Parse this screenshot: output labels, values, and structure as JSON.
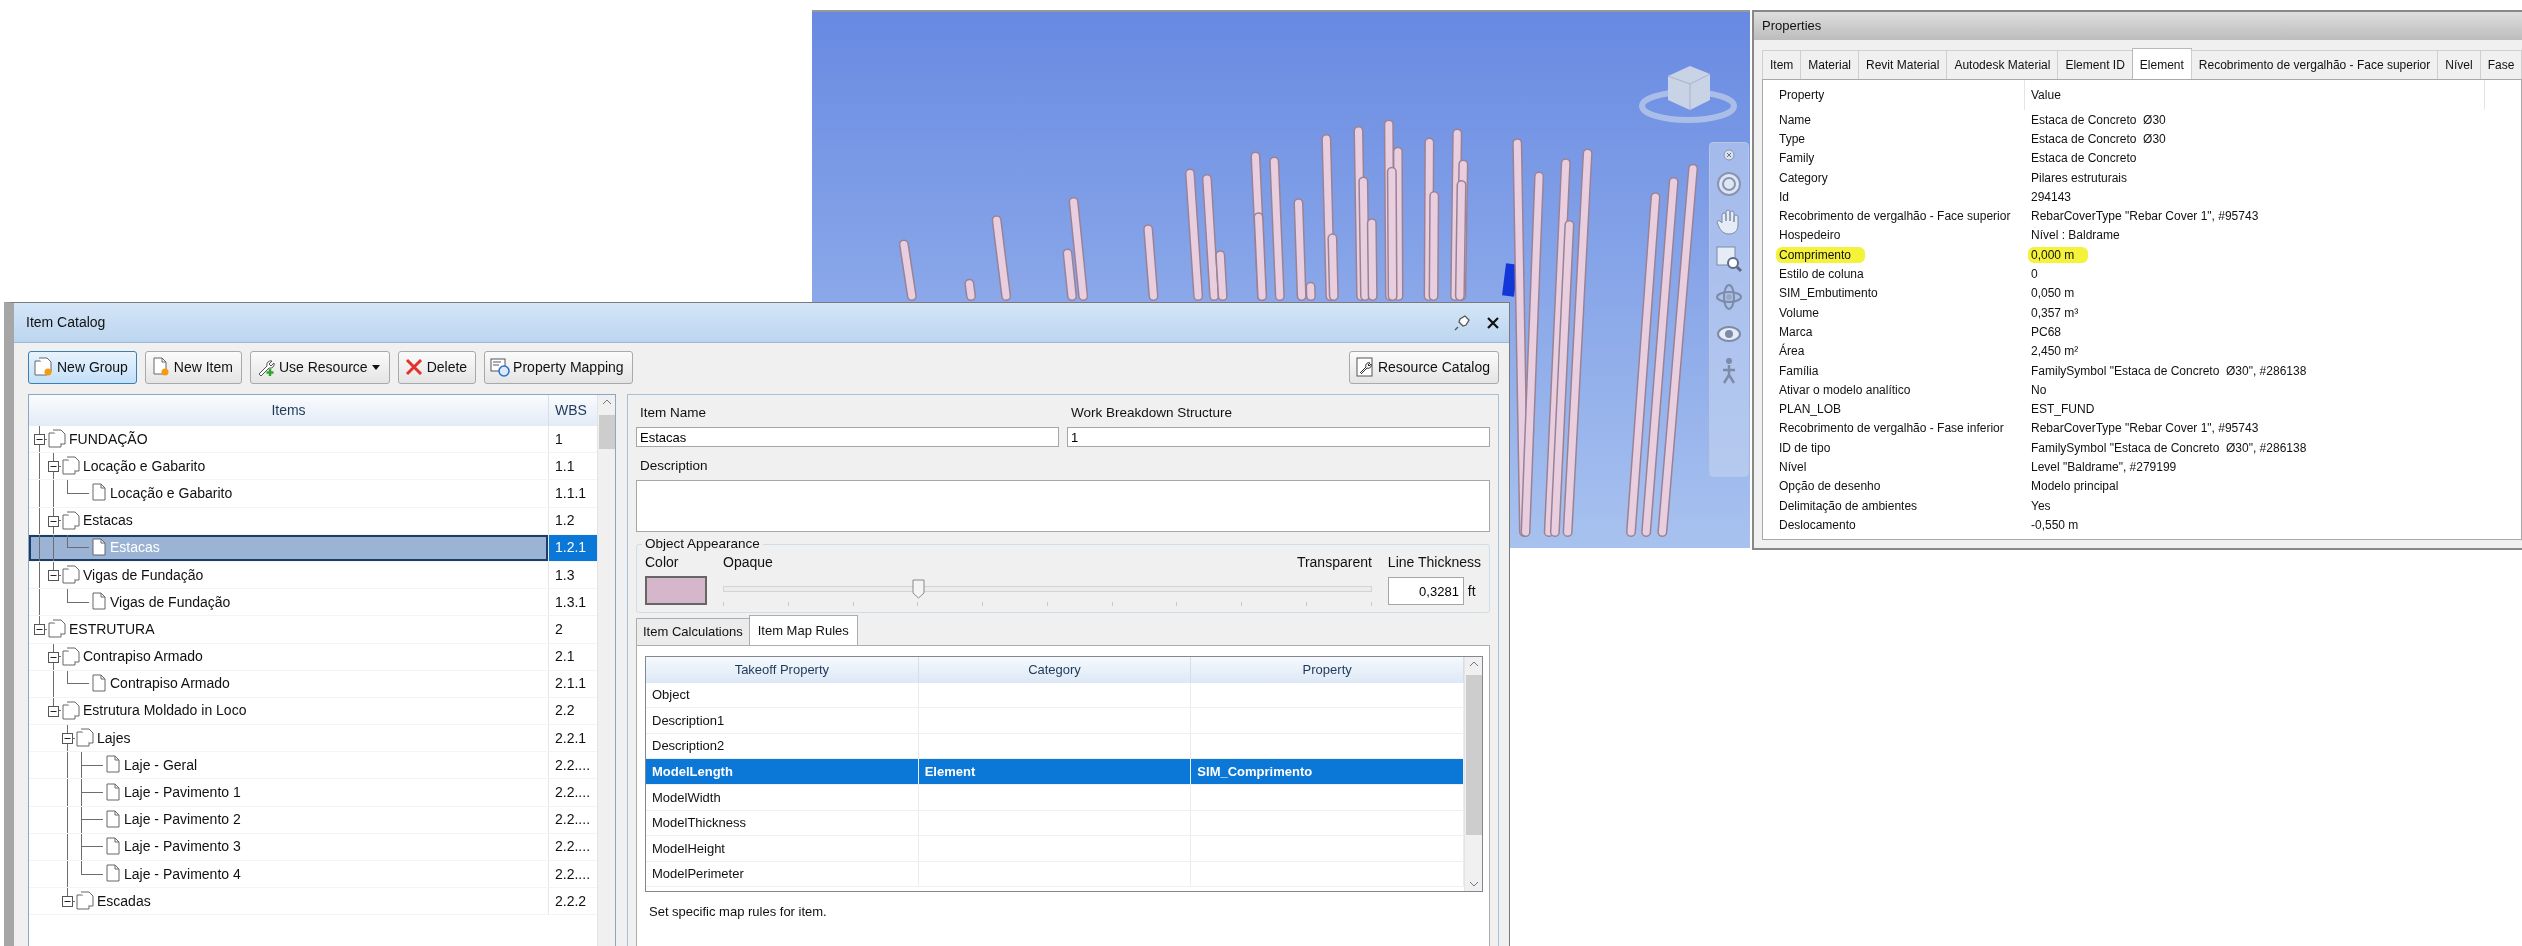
{
  "properties": {
    "title": "Properties",
    "tabs": [
      {
        "label": "Item",
        "selected": false
      },
      {
        "label": "Material",
        "selected": false
      },
      {
        "label": "Revit Material",
        "selected": false
      },
      {
        "label": "Autodesk Material",
        "selected": false
      },
      {
        "label": "Element ID",
        "selected": false
      },
      {
        "label": "Element",
        "selected": true
      },
      {
        "label": "Recobrimento de vergalhão - Face superior",
        "selected": false
      },
      {
        "label": "Nível",
        "selected": false
      },
      {
        "label": "Fase",
        "selected": false
      }
    ],
    "columns": [
      "Property",
      "Value"
    ],
    "rows": [
      {
        "property": "Name",
        "value": "Estaca de Concreto  Ø30",
        "highlighted": false
      },
      {
        "property": "Type",
        "value": "Estaca de Concreto  Ø30",
        "highlighted": false
      },
      {
        "property": "Family",
        "value": "Estaca de Concreto",
        "highlighted": false
      },
      {
        "property": "Category",
        "value": "Pilares estruturais",
        "highlighted": false
      },
      {
        "property": "Id",
        "value": "294143",
        "highlighted": false
      },
      {
        "property": "Recobrimento de vergalhão - Face superior",
        "value": "RebarCoverType \"Rebar Cover 1\", #95743",
        "highlighted": false
      },
      {
        "property": "Hospedeiro",
        "value": "Nível : Baldrame",
        "highlighted": false
      },
      {
        "property": "Comprimento",
        "value": "0,000 m",
        "highlighted": true
      },
      {
        "property": "Estilo de coluna",
        "value": "0",
        "highlighted": false
      },
      {
        "property": "SIM_Embutimento",
        "value": "0,050 m",
        "highlighted": false
      },
      {
        "property": "Volume",
        "value": "0,357 m³",
        "highlighted": false
      },
      {
        "property": "Marca",
        "value": "PC68",
        "highlighted": false
      },
      {
        "property": "Área",
        "value": "2,450 m²",
        "highlighted": false
      },
      {
        "property": "Família",
        "value": "FamilySymbol \"Estaca de Concreto  Ø30\", #286138",
        "highlighted": false
      },
      {
        "property": "Ativar o modelo analítico",
        "value": "No",
        "highlighted": false
      },
      {
        "property": "PLAN_LOB",
        "value": "EST_FUND",
        "highlighted": false
      },
      {
        "property": "Recobrimento de vergalhão - Fase inferior",
        "value": "RebarCoverType \"Rebar Cover 1\", #95743",
        "highlighted": false
      },
      {
        "property": "ID de tipo",
        "value": "FamilySymbol \"Estaca de Concreto  Ø30\", #286138",
        "highlighted": false
      },
      {
        "property": "Nível",
        "value": "Level \"Baldrame\", #279199",
        "highlighted": false
      },
      {
        "property": "Opção de desenho",
        "value": "Modelo principal",
        "highlighted": false
      },
      {
        "property": "Delimitação de ambientes",
        "value": "Yes",
        "highlighted": false
      },
      {
        "property": "Deslocamento",
        "value": "-0,550 m",
        "highlighted": false
      }
    ]
  },
  "item_catalog": {
    "title": "Item Catalog",
    "toolbar": [
      {
        "label": "New Group",
        "highlighted": true
      },
      {
        "label": "New Item",
        "highlighted": false
      },
      {
        "label": "Use Resource",
        "highlighted": false,
        "dropdown": true
      },
      {
        "label": "Delete",
        "highlighted": false
      },
      {
        "label": "Property Mapping",
        "highlighted": false
      }
    ],
    "resource_button": {
      "label": "Resource Catalog"
    },
    "tree": {
      "columns": [
        "Items",
        "WBS"
      ],
      "nodes": [
        {
          "label": "FUNDAÇÃO",
          "wbs": "1",
          "kind": "group",
          "expanded": true,
          "selected": false,
          "children": [
            {
              "label": "Locação e Gabarito",
              "wbs": "1.1",
              "kind": "group",
              "expanded": true,
              "selected": false,
              "children": [
                {
                  "label": "Locação e Gabarito",
                  "wbs": "1.1.1",
                  "kind": "item",
                  "selected": false
                }
              ]
            },
            {
              "label": "Estacas",
              "wbs": "1.2",
              "kind": "group",
              "expanded": true,
              "selected": false,
              "children": [
                {
                  "label": "Estacas",
                  "wbs": "1.2.1",
                  "kind": "item",
                  "selected": true
                }
              ]
            },
            {
              "label": "Vigas de Fundação",
              "wbs": "1.3",
              "kind": "group",
              "expanded": true,
              "selected": false,
              "children": [
                {
                  "label": "Vigas de Fundação",
                  "wbs": "1.3.1",
                  "kind": "item",
                  "selected": false
                }
              ]
            }
          ]
        },
        {
          "label": "ESTRUTURA",
          "wbs": "2",
          "kind": "group",
          "expanded": true,
          "selected": false,
          "children": [
            {
              "label": "Contrapiso Armado",
              "wbs": "2.1",
              "kind": "group",
              "expanded": true,
              "selected": false,
              "children": [
                {
                  "label": "Contrapiso Armado",
                  "wbs": "2.1.1",
                  "kind": "item",
                  "selected": false
                }
              ]
            },
            {
              "label": "Estrutura Moldado in Loco",
              "wbs": "2.2",
              "kind": "group",
              "expanded": true,
              "selected": false,
              "children": [
                {
                  "label": "Lajes",
                  "wbs": "2.2.1",
                  "kind": "group",
                  "expanded": true,
                  "selected": false,
                  "children": [
                    {
                      "label": "Laje - Geral",
                      "wbs": "2.2....",
                      "kind": "item",
                      "selected": false
                    },
                    {
                      "label": "Laje - Pavimento 1",
                      "wbs": "2.2....",
                      "kind": "item",
                      "selected": false
                    },
                    {
                      "label": "Laje - Pavimento 2",
                      "wbs": "2.2....",
                      "kind": "item",
                      "selected": false
                    },
                    {
                      "label": "Laje - Pavimento 3",
                      "wbs": "2.2....",
                      "kind": "item",
                      "selected": false
                    },
                    {
                      "label": "Laje - Pavimento 4",
                      "wbs": "2.2....",
                      "kind": "item",
                      "selected": false
                    }
                  ]
                },
                {
                  "label": "Escadas",
                  "wbs": "2.2.2",
                  "kind": "group",
                  "expanded": true,
                  "selected": false
                }
              ]
            }
          ]
        }
      ]
    },
    "details": {
      "item_name_label": "Item Name",
      "item_name": "Estacas",
      "wbs_label": "Work Breakdown Structure",
      "wbs": "1",
      "description_label": "Description",
      "appearance": {
        "legend": "Object Appearance",
        "color_label": "Color",
        "color": "#d6b6ca",
        "opaque_label": "Opaque",
        "transparent_label": "Transparent",
        "level": 0.3,
        "thickness_label": "Line Thickness",
        "thickness": "0,3281",
        "unit": "ft"
      },
      "tabs": [
        {
          "label": "Item Calculations",
          "selected": false
        },
        {
          "label": "Item Map Rules",
          "selected": true
        }
      ],
      "rules": {
        "columns": [
          "Takeoff Property",
          "Category",
          "Property"
        ],
        "rows": [
          {
            "cells": [
              "Object",
              "",
              ""
            ],
            "selected": false
          },
          {
            "cells": [
              "Description1",
              "",
              ""
            ],
            "selected": false
          },
          {
            "cells": [
              "Description2",
              "",
              ""
            ],
            "selected": false
          },
          {
            "cells": [
              "ModelLength",
              "Element",
              "SIM_Comprimento"
            ],
            "selected": true
          },
          {
            "cells": [
              "ModelWidth",
              "",
              ""
            ],
            "selected": false
          },
          {
            "cells": [
              "ModelThickness",
              "",
              ""
            ],
            "selected": false
          },
          {
            "cells": [
              "ModelHeight",
              "",
              ""
            ],
            "selected": false
          },
          {
            "cells": [
              "ModelPerimeter",
              "",
              ""
            ],
            "selected": false
          }
        ]
      },
      "hint": "Set specific map rules for item."
    }
  }
}
